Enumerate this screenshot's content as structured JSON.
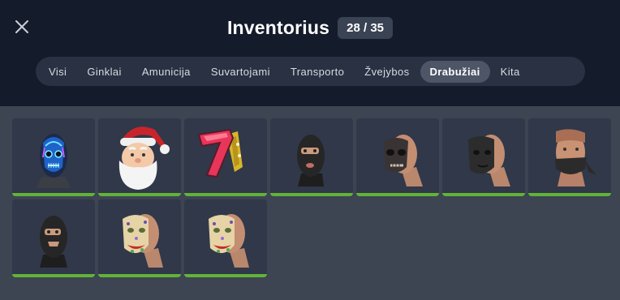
{
  "header": {
    "title": "Inventorius",
    "count": "28 / 35",
    "close_icon": "close-icon"
  },
  "tabs": [
    {
      "label": "Visi",
      "active": false
    },
    {
      "label": "Ginklai",
      "active": false
    },
    {
      "label": "Amunicija",
      "active": false
    },
    {
      "label": "Suvartojami",
      "active": false
    },
    {
      "label": "Transporto",
      "active": false
    },
    {
      "label": "Žvejybos",
      "active": false
    },
    {
      "label": "Drabužiai",
      "active": true
    },
    {
      "label": "Kita",
      "active": false
    }
  ],
  "colors": {
    "header_bg": "#141b2a",
    "body_bg": "#3d4452",
    "slot_bg": "#30384a",
    "durability_bar": "#62b339",
    "active_tab": "#4d5566"
  },
  "items": [
    {
      "icon": "neon-skull-mask-icon",
      "durability": 1.0
    },
    {
      "icon": "santa-mask-icon",
      "durability": 1.0
    },
    {
      "icon": "lucky-seven-mask-icon",
      "durability": 1.0
    },
    {
      "icon": "black-balaclava-icon",
      "durability": 1.0
    },
    {
      "icon": "skull-face-mask-icon",
      "durability": 1.0
    },
    {
      "icon": "black-face-mask-icon",
      "durability": 1.0
    },
    {
      "icon": "black-bandana-icon",
      "durability": 1.0
    },
    {
      "icon": "black-balaclava-open-icon",
      "durability": 1.0
    },
    {
      "icon": "clown-hockey-mask-icon",
      "durability": 1.0
    },
    {
      "icon": "clown-hockey-mask-icon",
      "durability": 1.0
    }
  ]
}
